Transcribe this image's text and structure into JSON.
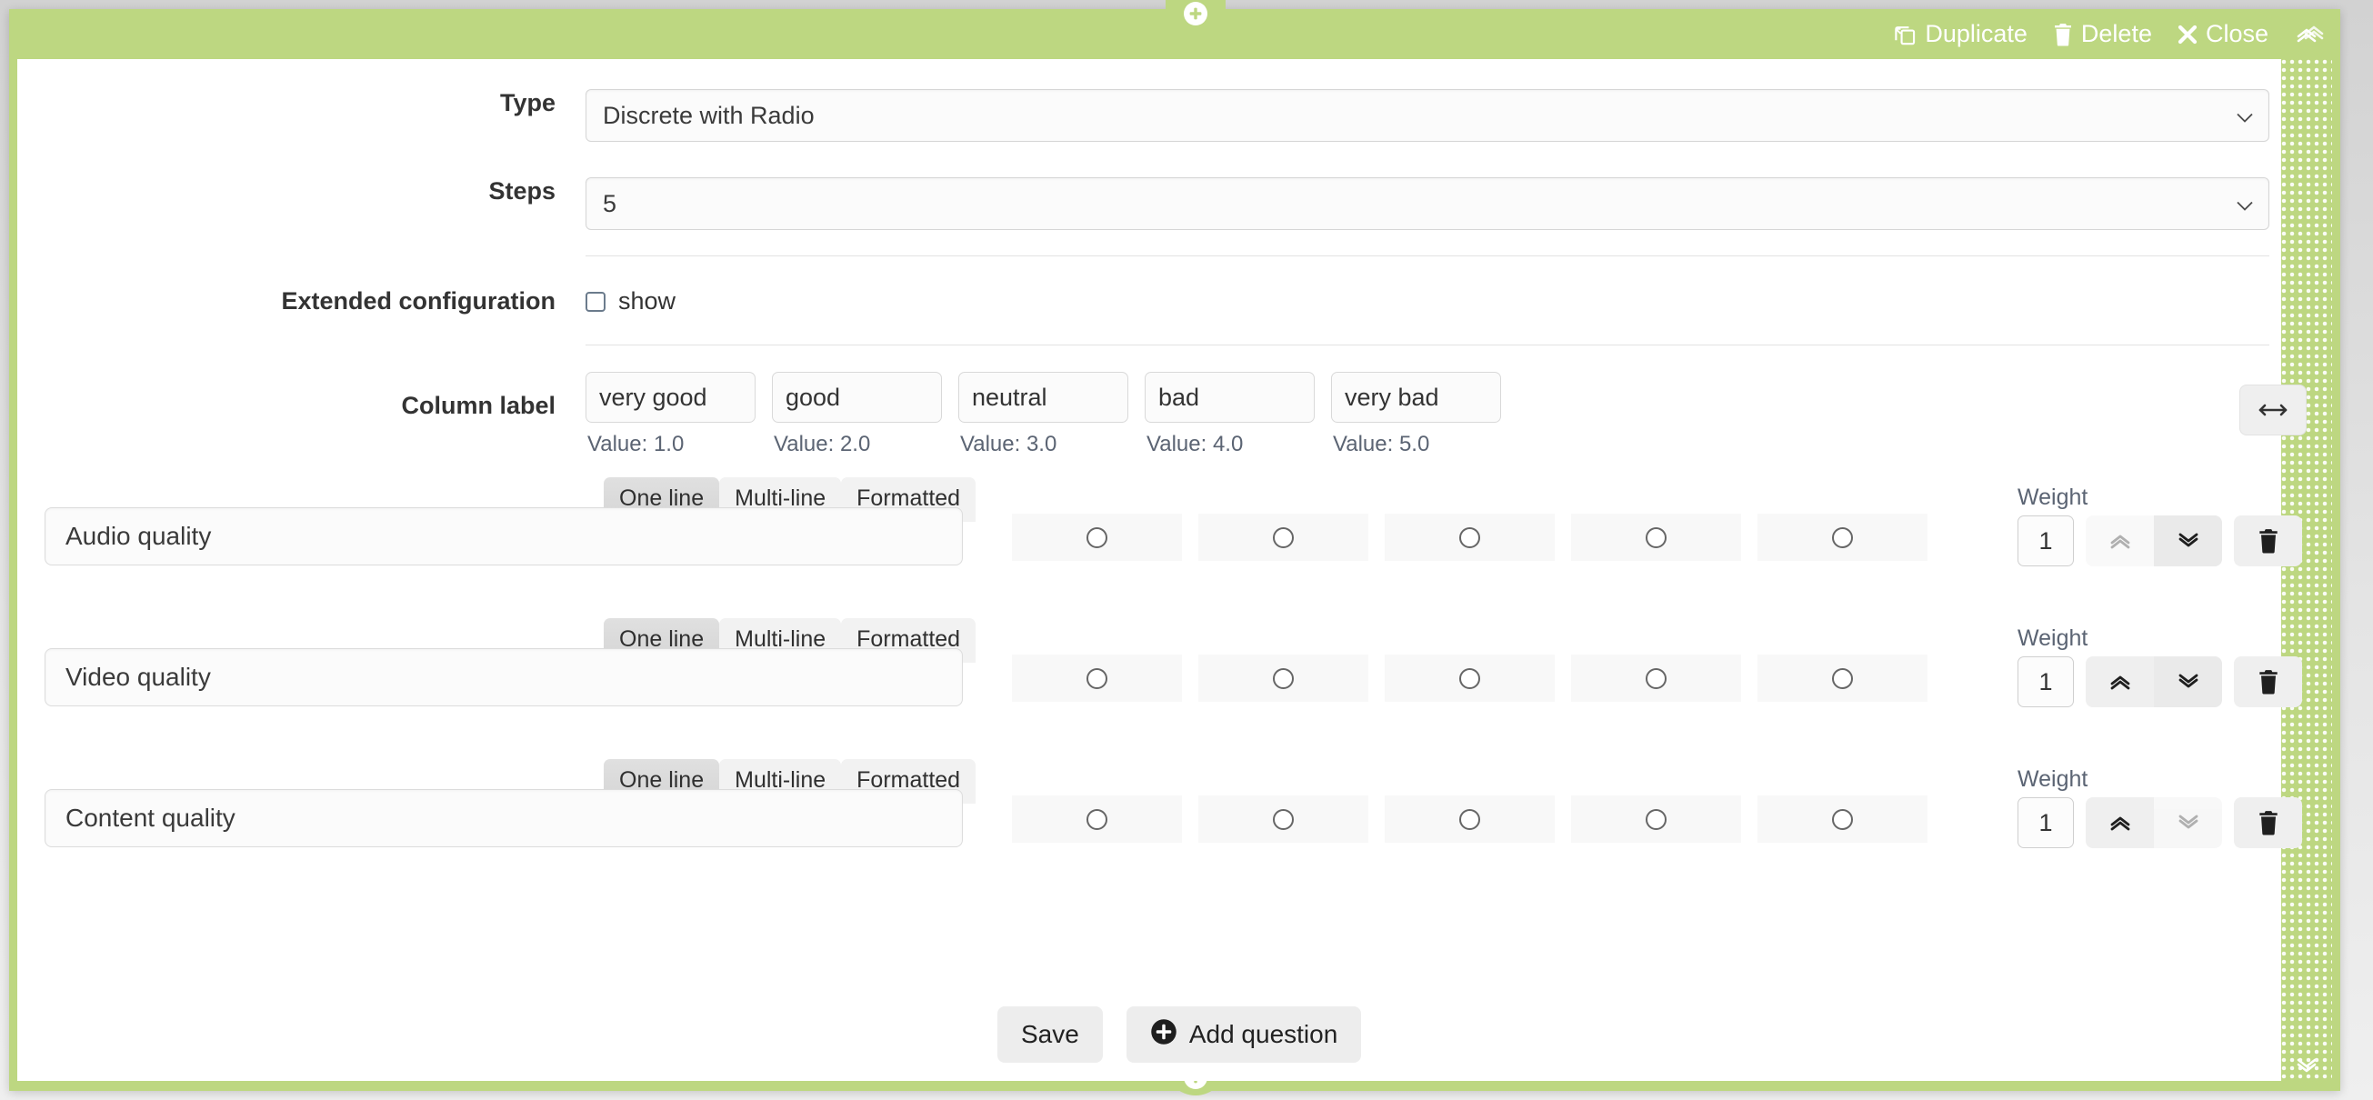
{
  "header": {
    "duplicate_label": "Duplicate",
    "delete_label": "Delete",
    "close_label": "Close",
    "accent_color": "#bdd781"
  },
  "form": {
    "type": {
      "label": "Type",
      "value": "Discrete with Radio"
    },
    "steps": {
      "label": "Steps",
      "value": "5"
    },
    "extended_configuration": {
      "label": "Extended configuration",
      "checkbox_label": "show",
      "checked": false
    },
    "column_label": {
      "label": "Column label",
      "columns": [
        {
          "text": "very good",
          "value_text": "Value: 1.0"
        },
        {
          "text": "good",
          "value_text": "Value: 2.0"
        },
        {
          "text": "neutral",
          "value_text": "Value: 3.0"
        },
        {
          "text": "bad",
          "value_text": "Value: 4.0"
        },
        {
          "text": "very bad",
          "value_text": "Value: 5.0"
        }
      ]
    }
  },
  "editor_tabs": {
    "one_line": "One line",
    "multi_line": "Multi-line",
    "formatted": "Formatted"
  },
  "weight_label": "Weight",
  "questions": [
    {
      "text": "Audio quality",
      "weight": "1",
      "up_enabled": false,
      "down_enabled": true
    },
    {
      "text": "Video quality",
      "weight": "1",
      "up_enabled": true,
      "down_enabled": true
    },
    {
      "text": "Content quality",
      "weight": "1",
      "up_enabled": true,
      "down_enabled": false
    }
  ],
  "footer": {
    "save_label": "Save",
    "add_question_label": "Add question"
  }
}
